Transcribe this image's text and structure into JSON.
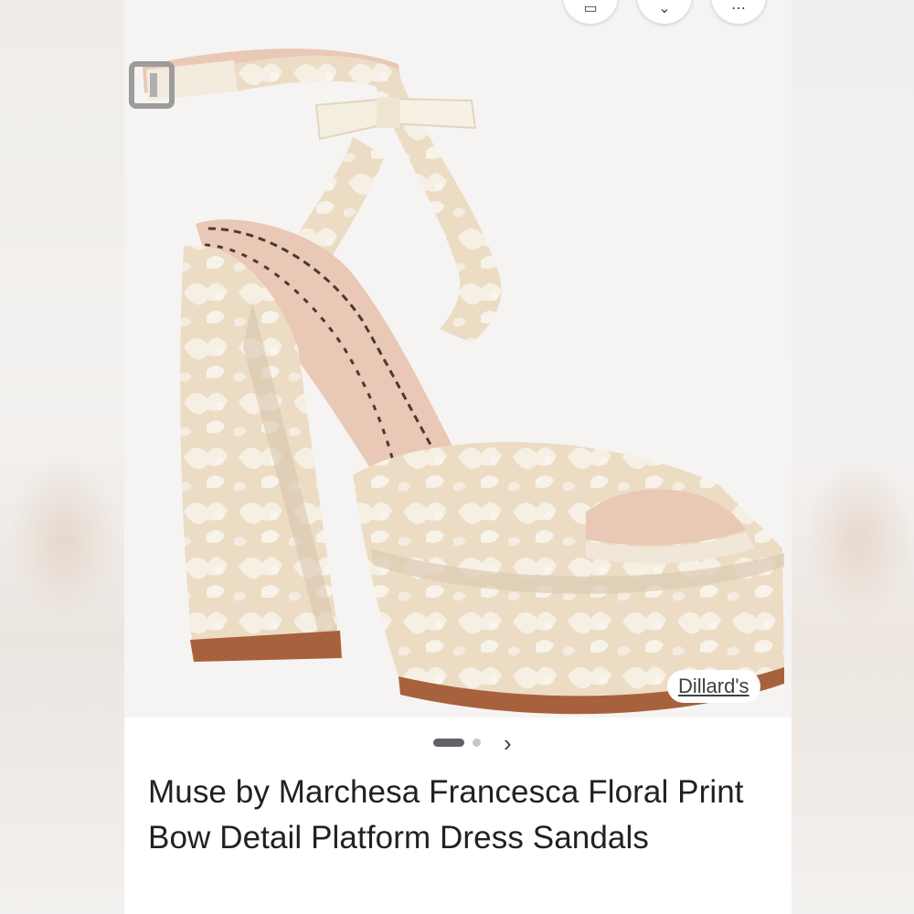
{
  "product": {
    "title": "Muse by Marchesa Francesca Floral Print Bow Detail Platform Dress Sandals",
    "image_alt": "Cream floral jacquard platform sandal with ankle strap and bow"
  },
  "source": {
    "label": "Dillard's"
  },
  "carousel": {
    "total": 2,
    "active": 1,
    "next_icon": "chevron-right-icon"
  },
  "top_actions": [
    {
      "icon": "share-icon"
    },
    {
      "icon": "save-icon"
    },
    {
      "icon": "more-icon"
    }
  ],
  "colors": {
    "fabric": "#efe4d2",
    "fabric_shadow": "#d9c7ae",
    "lining": "#e9c8b5",
    "sole": "#a8613d",
    "chip_bg": "#ffffff",
    "dot_active": "#5f6368",
    "dot_inactive": "#c4c7c5"
  }
}
